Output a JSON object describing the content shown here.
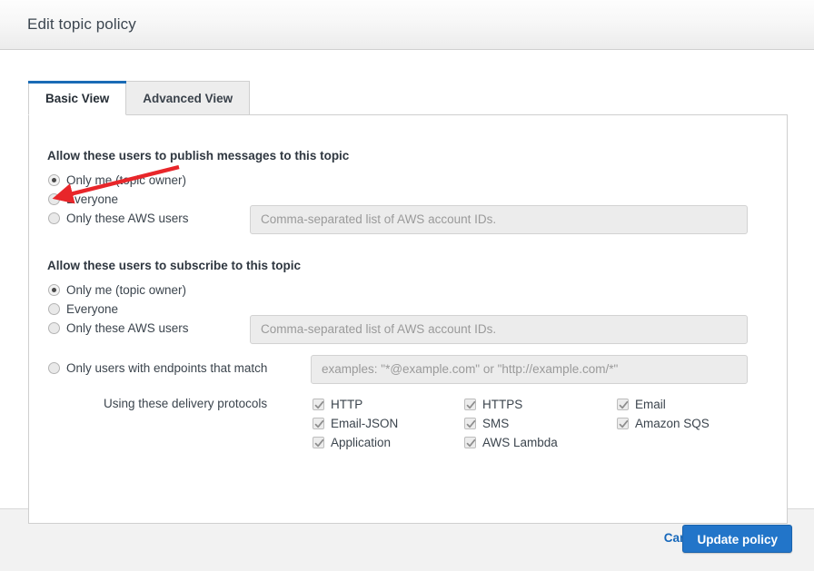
{
  "header": {
    "title": "Edit topic policy"
  },
  "tabs": [
    {
      "label": "Basic View",
      "active": true
    },
    {
      "label": "Advanced View",
      "active": false
    }
  ],
  "publish_section": {
    "heading": "Allow these users to publish messages to this topic",
    "options": [
      {
        "label": "Only me (topic owner)",
        "checked": true
      },
      {
        "label": "Everyone",
        "checked": false
      },
      {
        "label": "Only these AWS users",
        "checked": false
      }
    ],
    "accounts_input_placeholder": "Comma-separated list of AWS account IDs."
  },
  "subscribe_section": {
    "heading": "Allow these users to subscribe to this topic",
    "options": [
      {
        "label": "Only me (topic owner)",
        "checked": true
      },
      {
        "label": "Everyone",
        "checked": false
      },
      {
        "label": "Only these AWS users",
        "checked": false
      }
    ],
    "accounts_input_placeholder": "Comma-separated list of AWS account IDs.",
    "endpoints_option": {
      "label": "Only users with endpoints that match",
      "checked": false
    },
    "endpoints_input_placeholder": "examples: \"*@example.com\" or \"http://example.com/*\""
  },
  "protocols": {
    "label": "Using these delivery protocols",
    "items": [
      {
        "label": "HTTP",
        "checked": true
      },
      {
        "label": "HTTPS",
        "checked": true
      },
      {
        "label": "Email",
        "checked": true
      },
      {
        "label": "Email-JSON",
        "checked": true
      },
      {
        "label": "SMS",
        "checked": true
      },
      {
        "label": "Amazon SQS",
        "checked": true
      },
      {
        "label": "Application",
        "checked": true
      },
      {
        "label": "AWS Lambda",
        "checked": true
      }
    ]
  },
  "footer": {
    "cancel_label": "Cancel",
    "submit_label": "Update policy"
  },
  "annotation": {
    "type": "arrow",
    "color": "#e8262a",
    "points_at": "Everyone"
  },
  "colors": {
    "accent_blue": "#1a6bb5",
    "button_blue": "#2275c9",
    "link_blue": "#1668bb",
    "annotation_red": "#e8262a"
  }
}
